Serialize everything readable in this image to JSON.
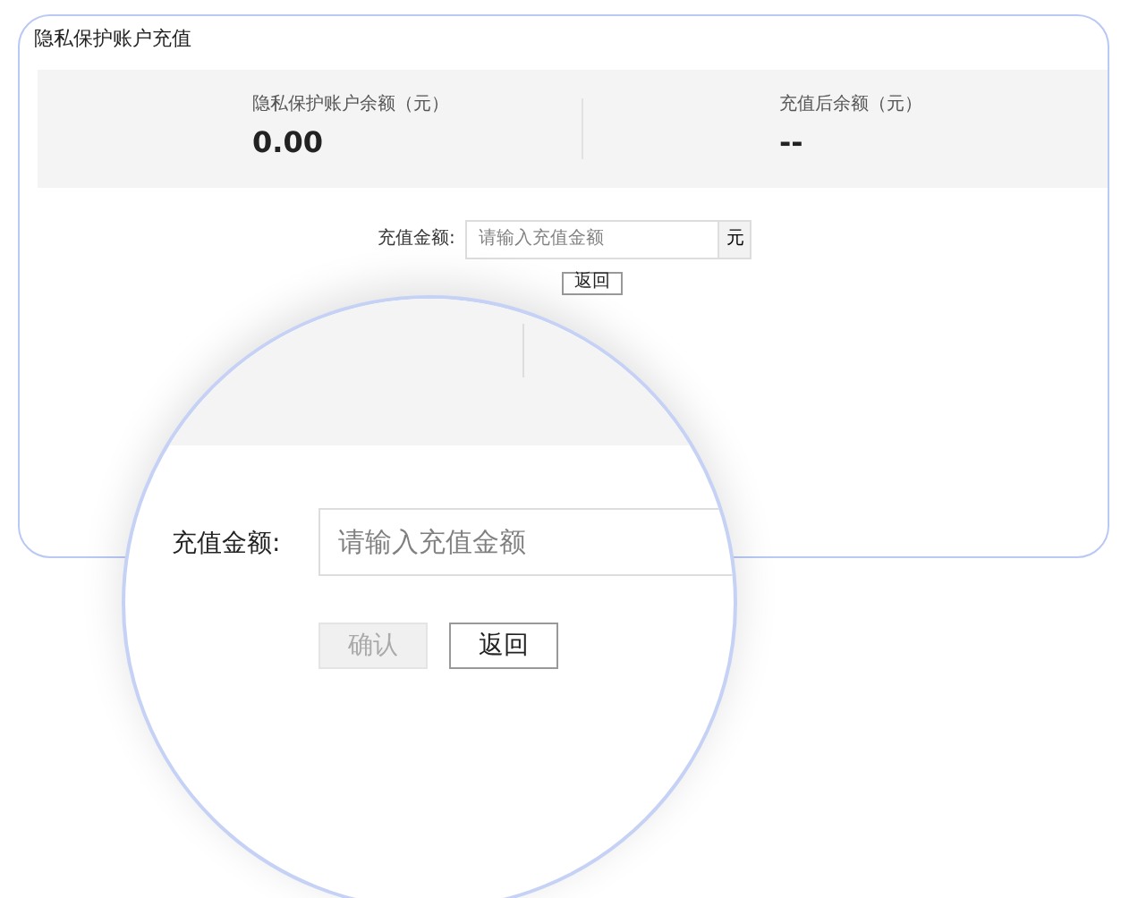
{
  "panel": {
    "title": "隐私保护账户充值",
    "stats": [
      {
        "label": "隐私保护账户余额（元）",
        "value": "0.00"
      },
      {
        "label": "充值后余额（元）",
        "value": "--"
      }
    ],
    "form": {
      "label": "充值金额:",
      "placeholder": "请输入充值金额",
      "unit": "元"
    },
    "buttons": [
      {
        "label": "返回",
        "disabled": false
      }
    ]
  },
  "magnifier": {
    "form": {
      "label": "充值金额:",
      "placeholder": "请输入充值金额"
    },
    "buttons": [
      {
        "label": "确认",
        "disabled": true
      },
      {
        "label": "返回",
        "disabled": false
      }
    ]
  }
}
